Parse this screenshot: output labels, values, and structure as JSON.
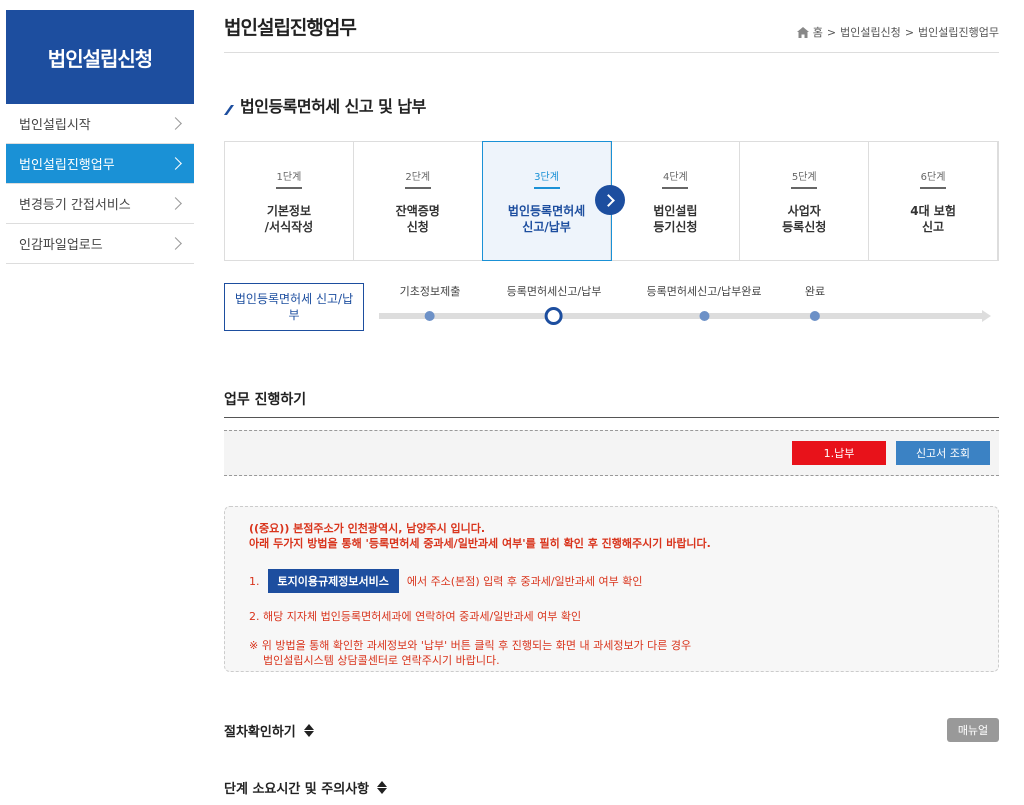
{
  "sidebar": {
    "title": "법인설립신청",
    "items": [
      {
        "label": "법인설립시작"
      },
      {
        "label": "법인설립진행업무"
      },
      {
        "label": "변경등기 간접서비스"
      },
      {
        "label": "인감파일업로드"
      }
    ]
  },
  "header": {
    "title": "법인설립진행업무",
    "breadcrumb": [
      "홈",
      "법인설립신청",
      "법인설립진행업무"
    ]
  },
  "section": {
    "title": "법인등록면허세 신고 및 납부"
  },
  "steps": [
    {
      "num": "1단계",
      "label": "기본정보\n/서식작성"
    },
    {
      "num": "2단계",
      "label": "잔액증명\n신청"
    },
    {
      "num": "3단계",
      "label": "법인등록면허세\n신고/납부"
    },
    {
      "num": "4단계",
      "label": "법인설립\n등기신청"
    },
    {
      "num": "5단계",
      "label": "사업자\n등록신청"
    },
    {
      "num": "6단계",
      "label": "4대 보험\n신고"
    }
  ],
  "progress": {
    "current_box": "법인등록면허세 신고/납부",
    "steps": [
      "기초정보제출",
      "등록면허세신고/납부",
      "등록면허세신고/납부완료",
      "완료"
    ]
  },
  "work": {
    "title": "업무 진행하기",
    "pay_button": "1.납부",
    "view_button": "신고서 조회"
  },
  "notice": {
    "line1": "((중요)) 본점주소가 인천광역시, 남양주시 입니다.",
    "line2": "아래 두가지 방법을 통해 '등록면허세 중과세/일반과세 여부'를 필히 확인 후 진행해주시기 바랍니다.",
    "item1_num": "1.",
    "item1_button": "토지이용규제정보서비스",
    "item1_text": "에서 주소(본점) 입력 후 중과세/일반과세 여부 확인",
    "item2": "2.  해당 지자체 법인등록면허세과에 연락하여 중과세/일반과세 여부 확인",
    "note1": "※ 위 방법을 통해 확인한 과세정보와 '납부' 버튼 클릭 후 진행되는 화면 내 과세정보가 다른 경우",
    "note2": "법인설립시스템 상담콜센터로 연락주시기 바랍니다."
  },
  "bottom": {
    "procedure_title": "절차확인하기",
    "manual_button": "매뉴얼",
    "time_title": "단계 소요시간 및 주의사항"
  },
  "colors": {
    "brand": "#1d4e9f",
    "active": "#1a91d6",
    "pay": "#e8121a",
    "notice_text": "#d9341c"
  }
}
